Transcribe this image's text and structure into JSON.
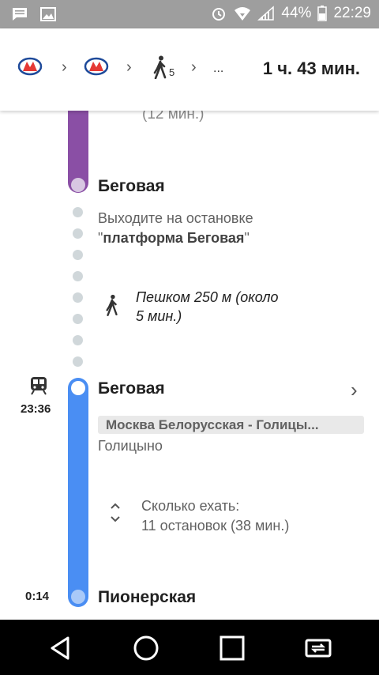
{
  "status_bar": {
    "icons_left": [
      "message-icon",
      "image-icon"
    ],
    "icons_right": [
      "alarm-icon",
      "wifi-icon",
      "signal-icon",
      "battery-icon"
    ],
    "battery": "44%",
    "time": "22:29"
  },
  "header": {
    "segments": [
      "metro-icon",
      "metro-icon",
      "walk-icon"
    ],
    "walk_minutes": "5",
    "ellipsis": "...",
    "duration": "1 ч. 43 мин."
  },
  "timeline": {
    "prev_duration": "(12 мин.)",
    "first_stop": "Беговая",
    "exit_line1": "Выходите на остановке",
    "exit_line2_quote_open": "\"",
    "exit_line2_name": "платформа Беговая",
    "exit_line2_quote_close": "\"",
    "walk_line1": "Пешком 250 м (около",
    "walk_line2": "5 мин.)",
    "train_stop": "Беговая",
    "train_time": "23:36",
    "direction": "Москва Белорусская - Голицы...",
    "terminal": "Голицыно",
    "ride_title": "Сколько ехать:",
    "ride_detail": "11 остановок (38 мин.)",
    "arrival_time": "0:14",
    "arrival_stop": "Пионерская"
  },
  "colors": {
    "metro_red": "#e53935",
    "metro_blue": "#1e4a9a",
    "purple_line": "#8a4fa5",
    "blue_line": "#4a8ef3"
  }
}
